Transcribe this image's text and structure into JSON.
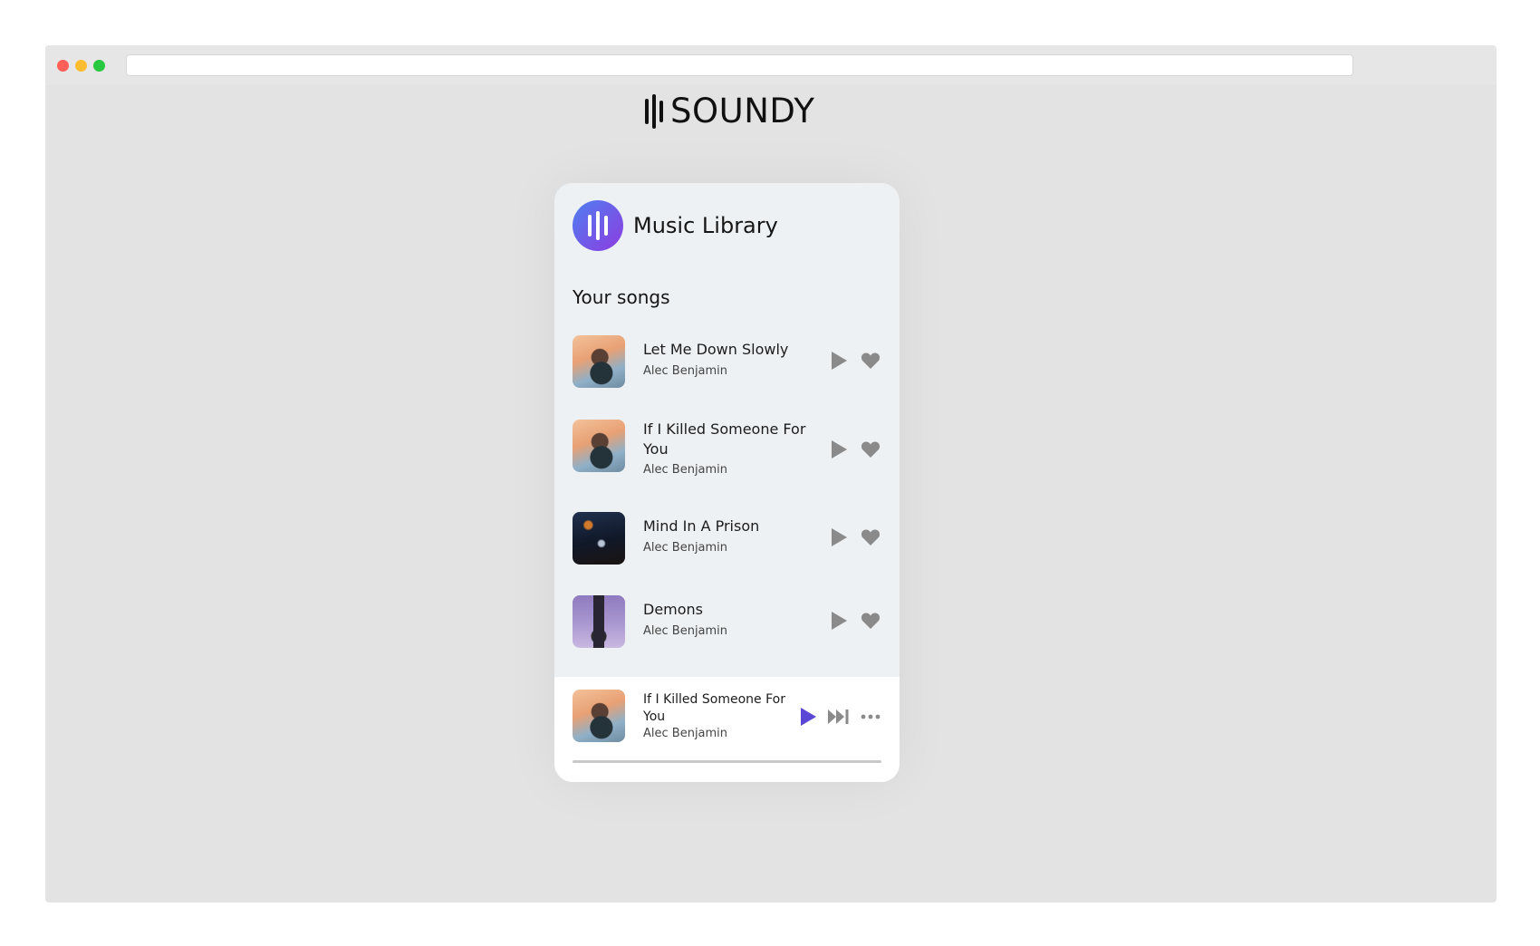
{
  "brand": {
    "name": "SOUNDY",
    "icon": "sound-bars-icon"
  },
  "library": {
    "title": "Music Library",
    "section_title": "Your songs",
    "logo_gradient": [
      "#4f7ff0",
      "#8d3ce0"
    ]
  },
  "songs": [
    {
      "title": "Let Me Down Slowly",
      "artist": "Alec Benjamin"
    },
    {
      "title": "If I Killed Someone For You",
      "artist": "Alec Benjamin"
    },
    {
      "title": "Mind In A Prison",
      "artist": "Alec Benjamin"
    },
    {
      "title": "Demons",
      "artist": "Alec Benjamin"
    }
  ],
  "now_playing": {
    "title": "If I Killed Someone For You",
    "artist": "Alec Benjamin",
    "progress": 0
  },
  "colors": {
    "accent": "#5b47d6",
    "icon_gray": "#8a8a8a"
  }
}
